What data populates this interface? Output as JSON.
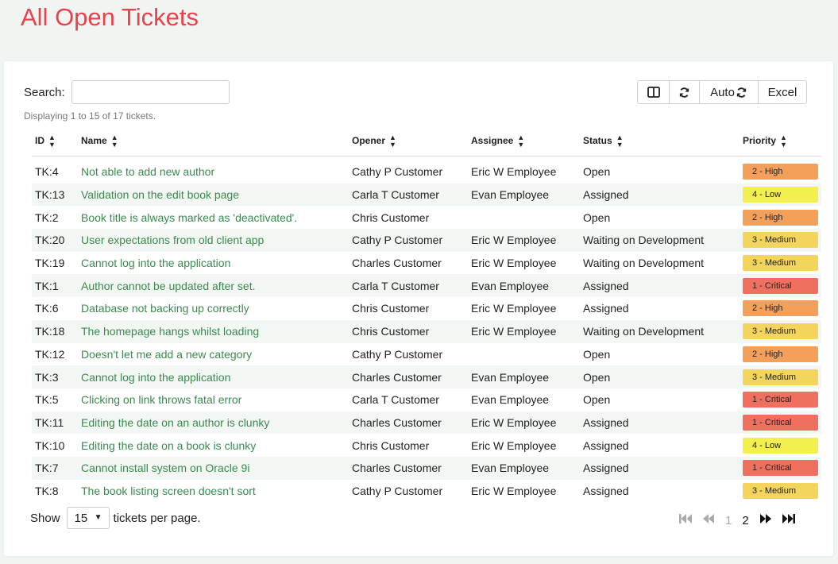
{
  "page": {
    "title": "All Open Tickets"
  },
  "search": {
    "label": "Search:",
    "value": "",
    "placeholder": ""
  },
  "display_info": "Displaying 1 to 15 of 17 tickets.",
  "toolbar": {
    "auto_label": "Auto",
    "excel_label": "Excel"
  },
  "table": {
    "headers": {
      "id": "ID",
      "name": "Name",
      "opener": "Opener",
      "assignee": "Assignee",
      "status": "Status",
      "priority": "Priority"
    },
    "rows": [
      {
        "id": "TK:4",
        "name": "Not able to add new author",
        "opener": "Cathy P Customer",
        "assignee": "Eric W Employee",
        "status": "Open",
        "priority": "2 - High"
      },
      {
        "id": "TK:13",
        "name": "Validation on the edit book page",
        "opener": "Carla T Customer",
        "assignee": "Evan Employee",
        "status": "Assigned",
        "priority": "4 - Low"
      },
      {
        "id": "TK:2",
        "name": "Book title is always marked as 'deactivated'.",
        "opener": "Chris Customer",
        "assignee": "",
        "status": "Open",
        "priority": "2 - High"
      },
      {
        "id": "TK:20",
        "name": "User expectations from old client app",
        "opener": "Cathy P Customer",
        "assignee": "Eric W Employee",
        "status": "Waiting on Development",
        "priority": "3 - Medium"
      },
      {
        "id": "TK:19",
        "name": "Cannot log into the application",
        "opener": "Charles Customer",
        "assignee": "Eric W Employee",
        "status": "Waiting on Development",
        "priority": "3 - Medium"
      },
      {
        "id": "TK:1",
        "name": "Author cannot be updated after set.",
        "opener": "Carla T Customer",
        "assignee": "Evan Employee",
        "status": "Assigned",
        "priority": "1 - Critical"
      },
      {
        "id": "TK:6",
        "name": "Database not backing up correctly",
        "opener": "Chris Customer",
        "assignee": "Eric W Employee",
        "status": "Assigned",
        "priority": "2 - High"
      },
      {
        "id": "TK:18",
        "name": "The homepage hangs whilst loading",
        "opener": "Chris Customer",
        "assignee": "Eric W Employee",
        "status": "Waiting on Development",
        "priority": "3 - Medium"
      },
      {
        "id": "TK:12",
        "name": "Doesn't let me add a new category",
        "opener": "Cathy P Customer",
        "assignee": "",
        "status": "Open",
        "priority": "2 - High"
      },
      {
        "id": "TK:3",
        "name": "Cannot log into the application",
        "opener": "Charles Customer",
        "assignee": "Evan Employee",
        "status": "Open",
        "priority": "3 - Medium"
      },
      {
        "id": "TK:5",
        "name": "Clicking on link throws fatal error",
        "opener": "Carla T Customer",
        "assignee": "Evan Employee",
        "status": "Open",
        "priority": "1 - Critical"
      },
      {
        "id": "TK:11",
        "name": "Editing the date on an author is clunky",
        "opener": "Charles Customer",
        "assignee": "Eric W Employee",
        "status": "Assigned",
        "priority": "1 - Critical"
      },
      {
        "id": "TK:10",
        "name": "Editing the date on a book is clunky",
        "opener": "Chris Customer",
        "assignee": "Eric W Employee",
        "status": "Assigned",
        "priority": "4 - Low"
      },
      {
        "id": "TK:7",
        "name": "Cannot install system on Oracle 9i",
        "opener": "Charles Customer",
        "assignee": "Evan Employee",
        "status": "Assigned",
        "priority": "1 - Critical"
      },
      {
        "id": "TK:8",
        "name": "The book listing screen doesn't sort",
        "opener": "Cathy P Customer",
        "assignee": "Eric W Employee",
        "status": "Assigned",
        "priority": "3 - Medium"
      }
    ]
  },
  "priority_colors": {
    "1 - Critical": "#f07060",
    "2 - High": "#f4a05a",
    "3 - Medium": "#f3d45c",
    "4 - Low": "#f2f04c"
  },
  "footer": {
    "show_label": "Show",
    "page_size": "15",
    "per_page_label": "tickets per page."
  },
  "pagination": {
    "pages": [
      "1",
      "2"
    ],
    "current": "2"
  },
  "icons": {
    "columns": "columns-icon",
    "refresh": "refresh-icon",
    "auto_refresh": "refresh-icon",
    "first": "first-page-icon",
    "prev": "previous-page-icon",
    "next": "next-page-icon",
    "last": "last-page-icon",
    "sort": "sort-icon"
  }
}
